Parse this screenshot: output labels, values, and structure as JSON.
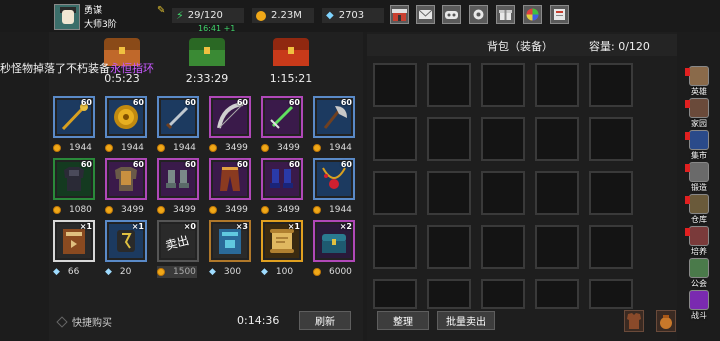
{
  "player": {
    "name": "勇谋",
    "rank": "大师3阶"
  },
  "resources": {
    "stamina": "29/120",
    "stamina_timer": "16:41 +1",
    "gold": "2.23M",
    "diamonds": "2703"
  },
  "colors": {
    "accent": "#f0a818",
    "purple": "#c858ff",
    "green": "#3fd46a"
  },
  "toolbar_icons": [
    "shop-icon",
    "mail-icon",
    "gamepad-icon",
    "settings-icon",
    "gift-icon",
    "color-wheel-icon",
    "notice-icon"
  ],
  "tip": {
    "prefix": "秒怪物掉落了不朽装备",
    "item": "永恒指环"
  },
  "chests": [
    {
      "timer": "0:5:23",
      "color": "#c0682a",
      "lid": "#8a4a18"
    },
    {
      "timer": "2:33:29",
      "color": "#3a8a34",
      "lid": "#2a6824"
    },
    {
      "timer": "1:15:21",
      "color": "#c83a1a",
      "lid": "#902810"
    }
  ],
  "shop": {
    "row1": [
      {
        "icon": "golden-staff-icon",
        "level": "60",
        "price": "1944",
        "currency": "gold",
        "border": "#5a8ac8"
      },
      {
        "icon": "round-shield-icon",
        "level": "60",
        "price": "1944",
        "currency": "gold",
        "border": "#5a8ac8"
      },
      {
        "icon": "dagger-icon",
        "level": "60",
        "price": "1944",
        "currency": "gold",
        "border": "#5a8ac8"
      },
      {
        "icon": "bow-icon",
        "level": "60",
        "price": "3499",
        "currency": "gold",
        "border": "#b048b8"
      },
      {
        "icon": "green-sword-icon",
        "level": "60",
        "price": "3499",
        "currency": "gold",
        "border": "#b048b8"
      },
      {
        "icon": "axe-icon",
        "level": "60",
        "price": "1944",
        "currency": "gold",
        "border": "#5a8ac8"
      }
    ],
    "row2": [
      {
        "icon": "dark-armor-icon",
        "level": "60",
        "price": "1080",
        "currency": "gold",
        "border": "#2a8a3a"
      },
      {
        "icon": "plate-armor-icon",
        "level": "60",
        "price": "3499",
        "currency": "gold",
        "border": "#b048b8"
      },
      {
        "icon": "iron-boots-icon",
        "level": "60",
        "price": "3499",
        "currency": "gold",
        "border": "#b048b8"
      },
      {
        "icon": "leather-pants-icon",
        "level": "60",
        "price": "3499",
        "currency": "gold",
        "border": "#b048b8"
      },
      {
        "icon": "blue-boots-icon",
        "level": "60",
        "price": "3499",
        "currency": "gold",
        "border": "#b048b8"
      },
      {
        "icon": "ruby-necklace-icon",
        "level": "60",
        "price": "1944",
        "currency": "gold",
        "border": "#5a8ac8"
      }
    ],
    "row3": [
      {
        "icon": "brown-book-icon",
        "level": "×1",
        "price": "66",
        "currency": "diamond",
        "border": "#d8d8d8"
      },
      {
        "icon": "rune-stone-icon",
        "level": "×1",
        "price": "20",
        "currency": "diamond",
        "border": "#5a8ac8"
      },
      {
        "icon": "sold-out-icon",
        "level": "×0",
        "price": "1500",
        "currency": "gold",
        "border": "#555555",
        "sold": "卖出"
      },
      {
        "icon": "blue-book-icon",
        "level": "×3",
        "price": "300",
        "currency": "diamond",
        "border": "#b0782a"
      },
      {
        "icon": "scroll-icon",
        "level": "×1",
        "price": "100",
        "currency": "diamond",
        "border": "#e0a020"
      },
      {
        "icon": "treasure-chest-icon",
        "level": "×2",
        "price": "6000",
        "currency": "gold",
        "border": "#b048b8"
      }
    ]
  },
  "footer_left": {
    "quick_buy": "快捷购买",
    "timer": "0:14:36",
    "refresh": "刷新"
  },
  "bag": {
    "title": "背包（装备）",
    "capacity": "容量: 0/120",
    "sort": "整理",
    "bulk_sell": "批量卖出"
  },
  "sidenav": [
    {
      "label": "英雄",
      "icon": "hero-icon"
    },
    {
      "label": "家园",
      "icon": "home-icon"
    },
    {
      "label": "集市",
      "icon": "market-icon"
    },
    {
      "label": "锻造",
      "icon": "anvil-icon"
    },
    {
      "label": "仓库",
      "icon": "warehouse-icon"
    },
    {
      "label": "培养",
      "icon": "train-icon"
    },
    {
      "label": "公会",
      "icon": "guild-icon"
    },
    {
      "label": "战斗",
      "icon": "battle-portal-icon"
    }
  ]
}
